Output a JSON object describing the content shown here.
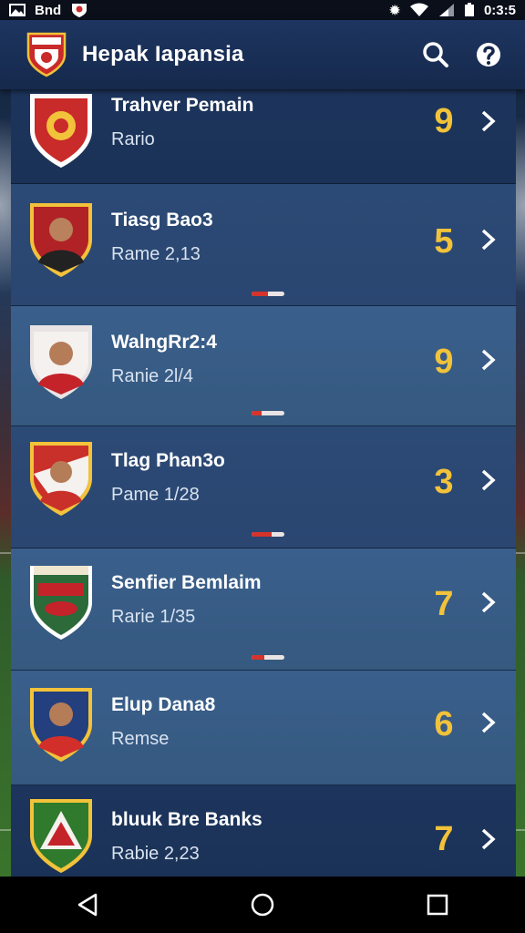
{
  "status_bar": {
    "left_icons": [
      "image-icon",
      "carrier-text",
      "app-badge-icon"
    ],
    "carrier": "Bnd",
    "time": "0:3:5",
    "right_icons": [
      "settings-icon",
      "wifi-icon",
      "signal-icon",
      "battery-icon"
    ]
  },
  "app_bar": {
    "title": "Hepak Iapansia",
    "logo": "club-crest-logo",
    "actions": [
      "search-icon",
      "help-icon"
    ]
  },
  "players": [
    {
      "name": "Trahver Pemain",
      "subtitle": "Rario",
      "rating": "9",
      "crest_color": "#c92a2a",
      "progress": null
    },
    {
      "name": "Tiasg Bao3",
      "subtitle": "Rame 2,13",
      "rating": "5",
      "crest_color": "#b12226",
      "progress": 0.5
    },
    {
      "name": "WalngRr2:4",
      "subtitle": "Ranie 2l/4",
      "rating": "9",
      "crest_color": "#c4232a",
      "progress": 0.3
    },
    {
      "name": "Tlag Phan3o",
      "subtitle": "Pame 1/28",
      "rating": "3",
      "crest_color": "#c9302a",
      "progress": 0.6
    },
    {
      "name": "Senfier Bemlaim",
      "subtitle": "Rarie 1/35",
      "rating": "7",
      "crest_color": "#2c6a3a",
      "progress": 0.4
    },
    {
      "name": "Elup Dana8",
      "subtitle": "Remse",
      "rating": "6",
      "crest_color": "#233f7d",
      "progress": null
    },
    {
      "name": "bluuk Bre Banks",
      "subtitle": "Rabie 2,23",
      "rating": "7",
      "crest_color": "#2f7a2c",
      "progress": null
    }
  ],
  "colors": {
    "rating": "#f2c23a",
    "accent_red": "#d6332b",
    "app_bar": "#1d3560"
  },
  "nav_bar": [
    "back-icon",
    "home-icon",
    "recents-icon"
  ]
}
